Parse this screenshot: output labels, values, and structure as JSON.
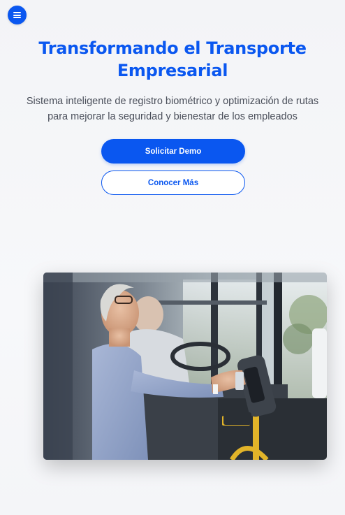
{
  "nav": {
    "menu_icon": "hamburger-menu-icon",
    "accent_color": "#0a57f0"
  },
  "hero": {
    "title": "Transformando el Transporte Empresarial",
    "subtitle": "Sistema inteligente de registro biométrico y optimización de rutas para mejorar la seguridad y bienestar de los empleados",
    "primary_cta": "Solicitar Demo",
    "secondary_cta": "Conocer Más",
    "image_alt": "Pasajera mayor registrándose con lector biométrico al subir a un autobús"
  }
}
